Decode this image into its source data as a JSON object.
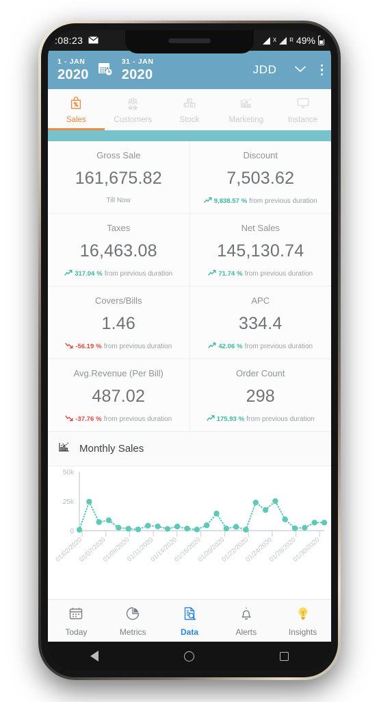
{
  "status_bar": {
    "time": ":08:23",
    "mail_icon": "envelope-icon",
    "signal_icon": "signal-bars-icon",
    "roaming_label": "X",
    "roaming_sub": "R",
    "battery": "49%"
  },
  "header": {
    "start_day": "1 - JAN",
    "start_year": "2020",
    "end_day": "31 - JAN",
    "end_year": "2020",
    "calendar_icon": "calendar-clock-icon",
    "brand": "JDD",
    "chevron_icon": "chevron-down-icon",
    "overflow_icon": "kebab-menu-icon",
    "bg_color": "#6ba5c4"
  },
  "tabs": {
    "active_index": 0,
    "accent": "#f08a3c",
    "items": [
      {
        "label": "Sales",
        "icon": "sales-tag-icon"
      },
      {
        "label": "Customers",
        "icon": "customers-group-icon"
      },
      {
        "label": "Stock",
        "icon": "stock-boxes-icon"
      },
      {
        "label": "Marketing",
        "icon": "marketing-chart-icon"
      },
      {
        "label": "Instance",
        "icon": "monitor-icon"
      }
    ]
  },
  "metrics": [
    [
      {
        "title": "Gross Sale",
        "value": "161,675.82",
        "sub": "Till Now",
        "pct": "",
        "dir": "none"
      },
      {
        "title": "Discount",
        "value": "7,503.62",
        "pct": "9,838.57",
        "sub": "from previous duration",
        "dir": "up"
      }
    ],
    [
      {
        "title": "Taxes",
        "value": "16,463.08",
        "pct": "317.04",
        "sub": "from previous duration",
        "dir": "up"
      },
      {
        "title": "Net Sales",
        "value": "145,130.74",
        "pct": "71.74",
        "sub": "from previous duration",
        "dir": "up"
      }
    ],
    [
      {
        "title": "Covers/Bills",
        "value": "1.46",
        "pct": "-56.19",
        "sub": "from previous duration",
        "dir": "down"
      },
      {
        "title": "APC",
        "value": "334.4",
        "pct": "42.06",
        "sub": "from previous duration",
        "dir": "up"
      }
    ],
    [
      {
        "title": "Avg.Revenue (Per Bill)",
        "value": "487.02",
        "pct": "-37.76",
        "sub": "from previous duration",
        "dir": "down"
      },
      {
        "title": "Order Count",
        "value": "298",
        "pct": "175.93",
        "sub": "from previous duration",
        "dir": "up"
      }
    ]
  ],
  "chart_section": {
    "icon": "bar-chart-icon",
    "title": "Monthly Sales"
  },
  "chart_data": {
    "type": "line",
    "title": "Monthly Sales",
    "xlabel": "",
    "ylabel": "",
    "ylim": [
      0,
      50000
    ],
    "ytick_labels": [
      "0",
      "25k",
      "50k"
    ],
    "ytick_values": [
      0,
      25000,
      50000
    ],
    "grid": false,
    "legend": false,
    "marker_color": "#5fc9b7",
    "line_style": "dotted",
    "xtick_labels": [
      "01/02/2020",
      "01/07/2020",
      "01/09/2020",
      "01/11/2020",
      "01/14/2020",
      "01/16/2020",
      "01/20/2020",
      "01/22/2020",
      "01/24/2020",
      "01/28/2020",
      "01/30/2020"
    ],
    "x": [
      "01/02/2020",
      "01/03/2020",
      "01/07/2020",
      "01/08/2020",
      "01/09/2020",
      "01/10/2020",
      "01/11/2020",
      "01/12/2020",
      "01/13/2020",
      "01/14/2020",
      "01/15/2020",
      "01/16/2020",
      "01/17/2020",
      "01/18/2020",
      "01/20/2020",
      "01/21/2020",
      "01/22/2020",
      "01/23/2020",
      "01/24/2020",
      "01/25/2020",
      "01/26/2020",
      "01/27/2020",
      "01/28/2020",
      "01/29/2020",
      "01/30/2020",
      "01/31/2020"
    ],
    "values": [
      700,
      24500,
      7200,
      8800,
      2500,
      1600,
      1000,
      4200,
      3600,
      1500,
      3500,
      1700,
      900,
      4500,
      14500,
      1800,
      3200,
      800,
      23800,
      17500,
      25000,
      9500,
      2000,
      2400,
      6800,
      6800
    ]
  },
  "bottom_nav": {
    "active_index": 2,
    "active_color": "#2e86d9",
    "items": [
      {
        "label": "Today",
        "icon": "calendar-icon"
      },
      {
        "label": "Metrics",
        "icon": "pie-chart-icon"
      },
      {
        "label": "Data",
        "icon": "data-search-icon"
      },
      {
        "label": "Alerts",
        "icon": "bell-icon"
      },
      {
        "label": "Insights",
        "icon": "lightbulb-icon"
      }
    ]
  },
  "android_nav": {
    "back": "back-icon",
    "home": "home-icon",
    "recents": "recents-icon"
  }
}
